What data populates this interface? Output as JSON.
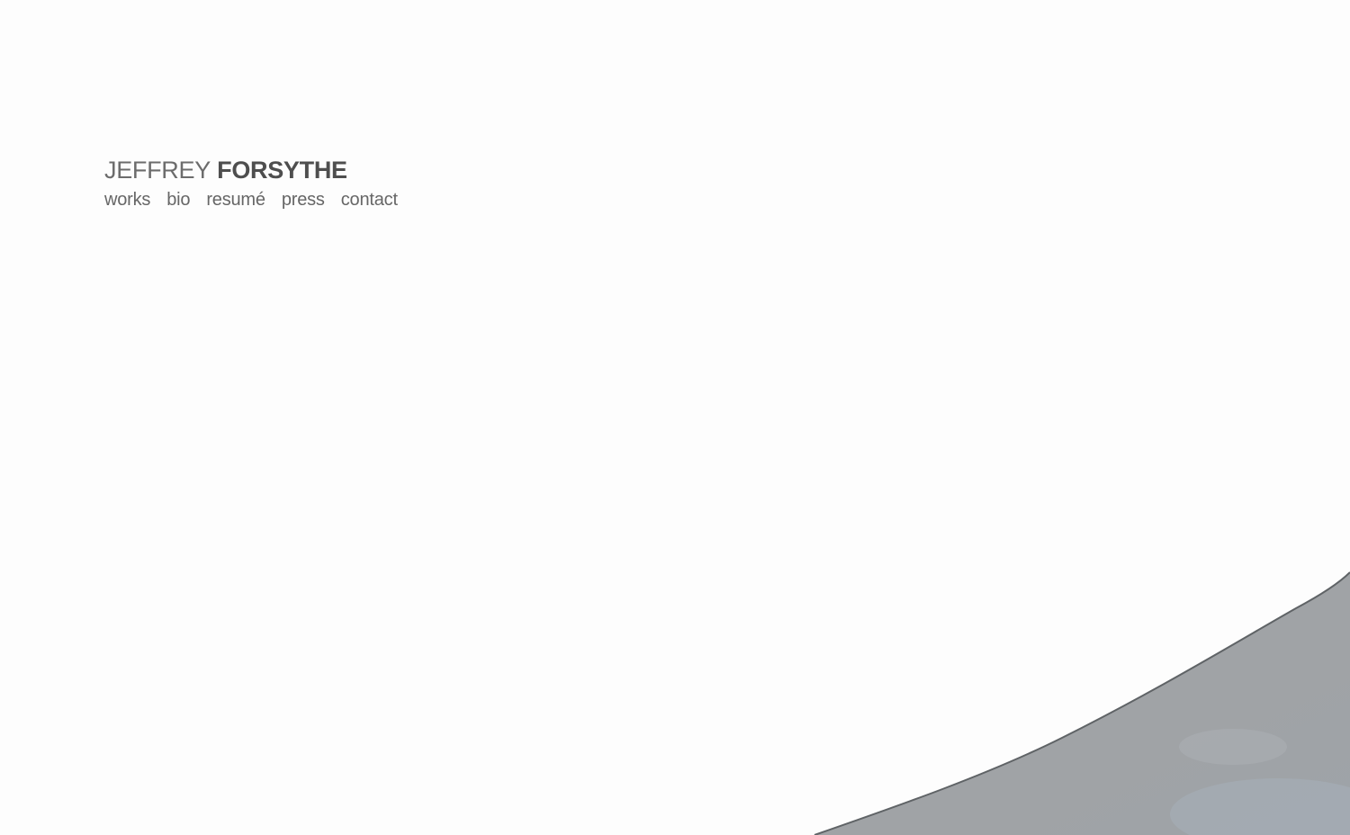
{
  "site": {
    "first_name": "JEFFREY",
    "last_name": "FORSYTHE"
  },
  "nav": {
    "items": [
      {
        "label": "works"
      },
      {
        "label": "bio"
      },
      {
        "label": "resumé"
      },
      {
        "label": "press"
      },
      {
        "label": "contact"
      }
    ]
  },
  "artwork": {
    "colors": {
      "fill": "#a0a0a0",
      "edge": "#5f6366",
      "tint": "#a8b3be"
    }
  }
}
